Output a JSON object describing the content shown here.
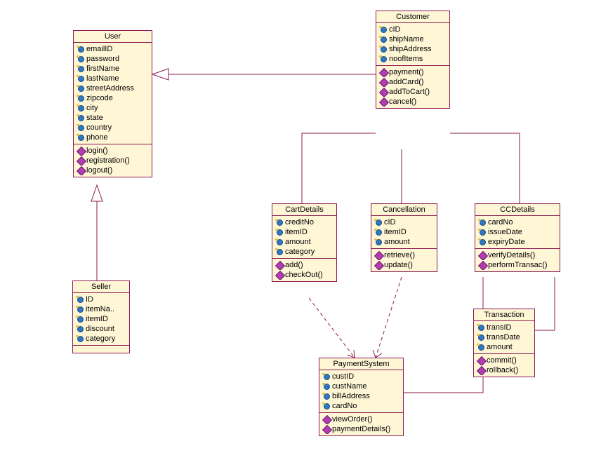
{
  "diagram_type": "UML Class Diagram",
  "classes": {
    "user": {
      "name": "User",
      "attrs": [
        "emailID",
        "password",
        "firstName",
        "lastName",
        "streetAddress",
        "zipcode",
        "city",
        "state",
        "country",
        "phone"
      ],
      "ops": [
        "login()",
        "registration()",
        "logout()"
      ]
    },
    "customer": {
      "name": "Customer",
      "attrs": [
        "cID",
        "shipName",
        "shipAddress",
        "noofItems"
      ],
      "ops": [
        "payment()",
        "addCard()",
        "addToCart()",
        "cancel()"
      ]
    },
    "seller": {
      "name": "Seller",
      "attrs": [
        "ID",
        "itemNa..",
        "itemID",
        "discount",
        "category"
      ],
      "ops": []
    },
    "cartDetails": {
      "name": "CartDetails",
      "attrs": [
        "creditNo",
        "itemID",
        "amount",
        "category"
      ],
      "ops": [
        "add()",
        "checkOut()"
      ]
    },
    "cancellation": {
      "name": "Cancellation",
      "attrs": [
        "cID",
        "itemID",
        "amount"
      ],
      "ops": [
        "retrieve()",
        "update()"
      ]
    },
    "ccDetails": {
      "name": "CCDetails",
      "attrs": [
        "cardNo",
        "issueDate",
        "expiryDate"
      ],
      "ops": [
        "verifyDetails()",
        "performTransac()"
      ]
    },
    "transaction": {
      "name": "Transaction",
      "attrs": [
        "transID",
        "transDate",
        "amount"
      ],
      "ops": [
        "commit()",
        "rollback()"
      ]
    },
    "paymentSystem": {
      "name": "PaymentSystem",
      "attrs": [
        "custID",
        "custName",
        "billAddress",
        "cardNo"
      ],
      "ops": [
        "viewOrder()",
        "paymentDetails()"
      ]
    }
  },
  "relationships": [
    {
      "from": "Customer",
      "to": "User",
      "type": "generalization"
    },
    {
      "from": "Seller",
      "to": "User",
      "type": "generalization"
    },
    {
      "from": "Customer",
      "to": "CartDetails",
      "type": "association"
    },
    {
      "from": "Customer",
      "to": "Cancellation",
      "type": "association"
    },
    {
      "from": "Customer",
      "to": "CCDetails",
      "type": "association"
    },
    {
      "from": "CCDetails",
      "to": "Transaction",
      "type": "association"
    },
    {
      "from": "CCDetails",
      "to": "PaymentSystem",
      "type": "association"
    },
    {
      "from": "CartDetails",
      "to": "PaymentSystem",
      "type": "dependency"
    },
    {
      "from": "Cancellation",
      "to": "PaymentSystem",
      "type": "dependency"
    }
  ]
}
